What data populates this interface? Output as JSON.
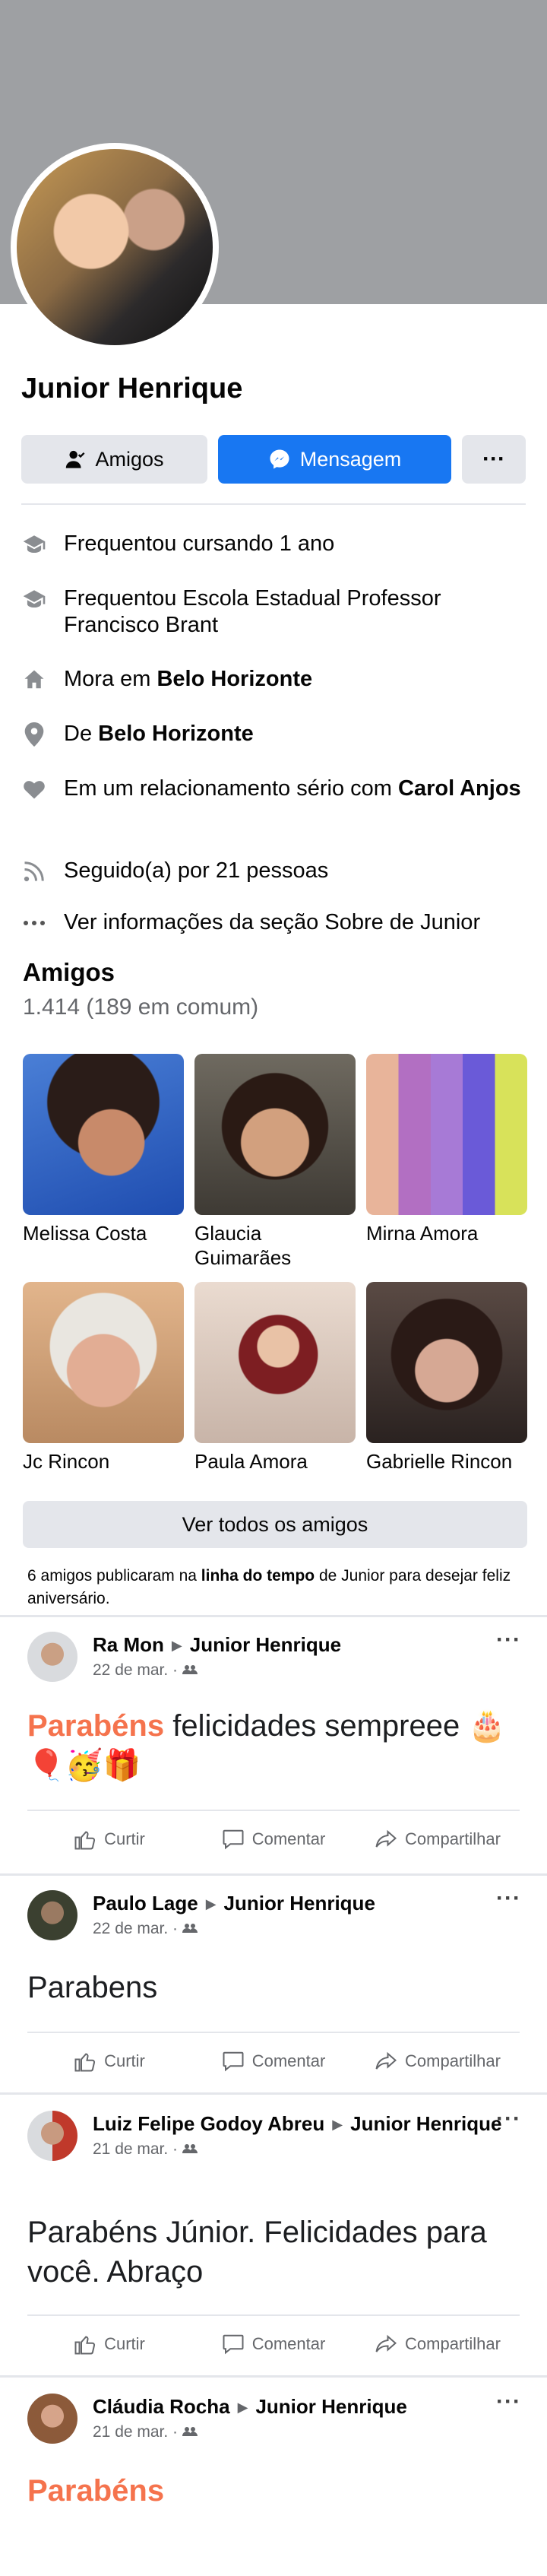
{
  "profile": {
    "name": "Junior Henrique",
    "friends_button": "Amigos",
    "message_button": "Mensagem",
    "more_button": "···"
  },
  "intro": [
    {
      "icon": "graduation-cap-icon",
      "pre": "Frequentou cursando 1 ano",
      "bold": "",
      "post": ""
    },
    {
      "icon": "graduation-cap-icon",
      "pre": "Frequentou Escola Estadual Professor Francisco Brant",
      "bold": "",
      "post": ""
    },
    {
      "icon": "home-icon",
      "pre": "Mora em ",
      "bold": "Belo Horizonte",
      "post": ""
    },
    {
      "icon": "location-pin-icon",
      "pre": "De ",
      "bold": "Belo Horizonte",
      "post": ""
    },
    {
      "icon": "heart-icon",
      "pre": "Em um relacionamento sério com ",
      "bold": "Carol Anjos",
      "post": ""
    },
    {
      "icon": "rss-feed-icon",
      "pre": "Seguido(a) por 21 pessoas",
      "bold": "",
      "post": ""
    },
    {
      "icon": "ellipsis-icon",
      "pre": "Ver informações da seção Sobre de Junior",
      "bold": "",
      "post": ""
    }
  ],
  "friends": {
    "heading": "Amigos",
    "count": "1.414 (189 em comum)",
    "list": [
      {
        "name": "Melissa Costa"
      },
      {
        "name": "Glaucia Guimarães"
      },
      {
        "name": "Mirna Amora"
      },
      {
        "name": "Jc Rincon"
      },
      {
        "name": "Paula Amora"
      },
      {
        "name": "Gabrielle Rincon"
      }
    ],
    "see_all": "Ver todos os amigos"
  },
  "birthday_notice": {
    "pre": "6 amigos publicaram na ",
    "bold": "linha do tempo",
    "post": " de Junior para desejar feliz aniversário."
  },
  "posts": [
    {
      "author": "Ra Mon",
      "target": "Junior Henrique",
      "date": "22 de mar. ·",
      "highlight": "Parabéns",
      "text": " felicidades sempreee 🎂🎈🥳🎁"
    },
    {
      "author": "Paulo Lage",
      "target": "Junior Henrique",
      "date": "22 de mar. ·",
      "highlight": "",
      "text": "Parabens"
    },
    {
      "author": "Luiz Felipe Godoy Abreu",
      "target": "Junior Henrique",
      "date": "21 de mar. ·",
      "highlight": "",
      "text": "Parabéns Júnior. Felicidades para você. Abraço"
    },
    {
      "author": "Cláudia Rocha",
      "target": "Junior Henrique",
      "date": "21 de mar. ·",
      "highlight": "Parabéns",
      "text": ""
    }
  ],
  "actions": {
    "like": "Curtir",
    "comment": "Comentar",
    "share": "Compartilhar"
  },
  "colors": {
    "primary": "#1877f2",
    "highlight": "#f5734d",
    "secondary_text": "#65676b"
  }
}
